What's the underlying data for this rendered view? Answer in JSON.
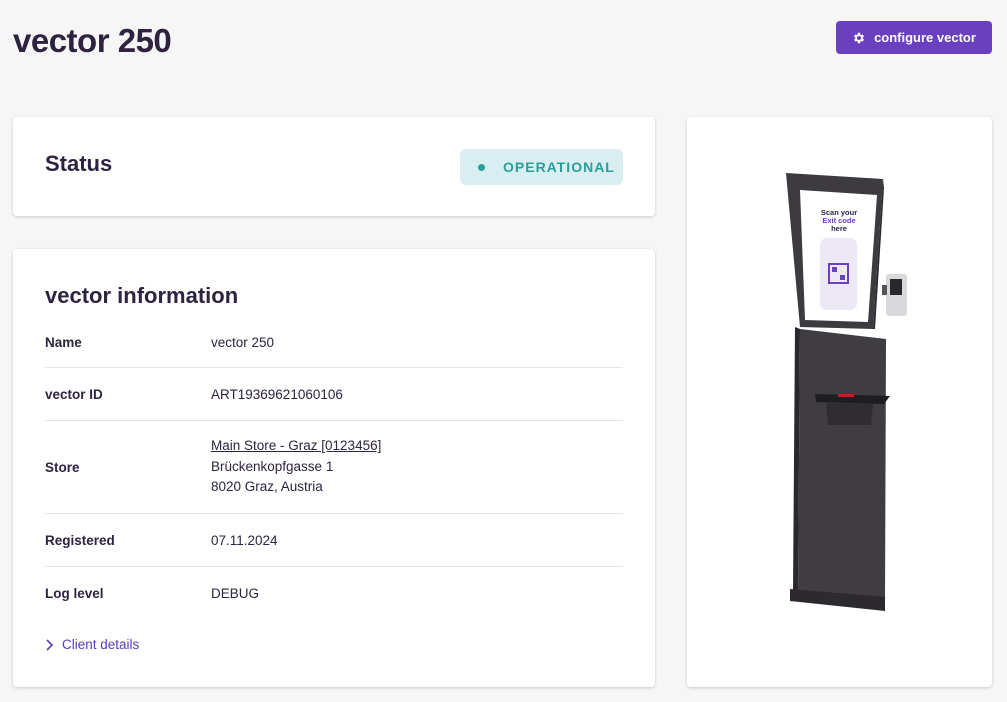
{
  "header": {
    "title": "vector 250",
    "configure_label": "configure vector"
  },
  "status": {
    "title": "Status",
    "badge_label": "OPERATIONAL",
    "badge_color": "#2a9e9a"
  },
  "info": {
    "title": "vector information",
    "rows": [
      {
        "label": "Name",
        "value": "vector 250"
      },
      {
        "label": "vector ID",
        "value": "ART19369621060106"
      },
      {
        "label": "Store",
        "link": "Main Store - Graz [0123456]",
        "address1": "Brückenkopfgasse 1",
        "address2": "8020 Graz, Austria"
      },
      {
        "label": "Registered",
        "value": "07.11.2024"
      },
      {
        "label": "Log level",
        "value": "DEBUG"
      }
    ],
    "client_details_label": "Client details"
  },
  "kiosk_screen": {
    "line1": "Scan your",
    "line2": "Exit code",
    "line3": "here"
  },
  "colors": {
    "accent": "#6a3fc0",
    "background": "#f6f6f6",
    "text": "#2d2340"
  }
}
